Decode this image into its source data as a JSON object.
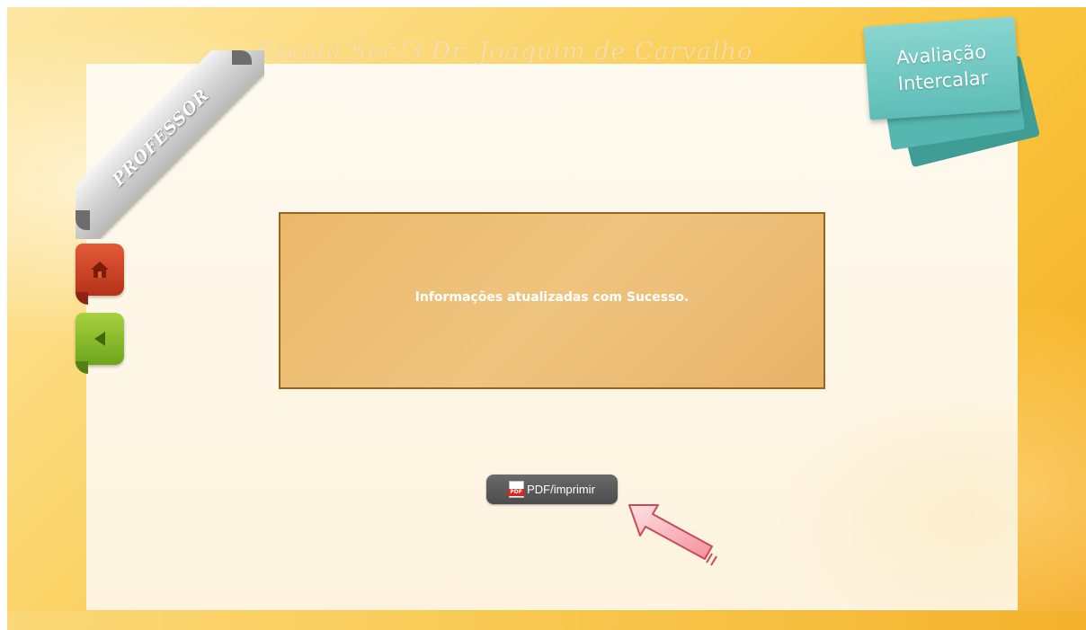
{
  "header": {
    "school_title": "Escola Sec/3 Dr. Joaquim de Carvalho",
    "role_ribbon": "PROFESSOR",
    "sticky_line1": "Avaliação",
    "sticky_line2": "Intercalar"
  },
  "sidebar": {
    "home_icon": "home-icon",
    "back_icon": "arrow-left-icon"
  },
  "main": {
    "message": "Informações atualizadas com Sucesso.",
    "pdf_button_label": "PDF/imprimir",
    "pdf_icon": "pdf-icon",
    "pdf_icon_tag": "PDF"
  },
  "colors": {
    "background": "#f8c53e",
    "panel": "#fdf3de",
    "message_box": "#eab86b",
    "sticky_note": "#5dbdb6",
    "home_button": "#c7401f",
    "back_button": "#8cc12c",
    "pdf_button": "#555555",
    "arrow": "#f7a8b0"
  }
}
